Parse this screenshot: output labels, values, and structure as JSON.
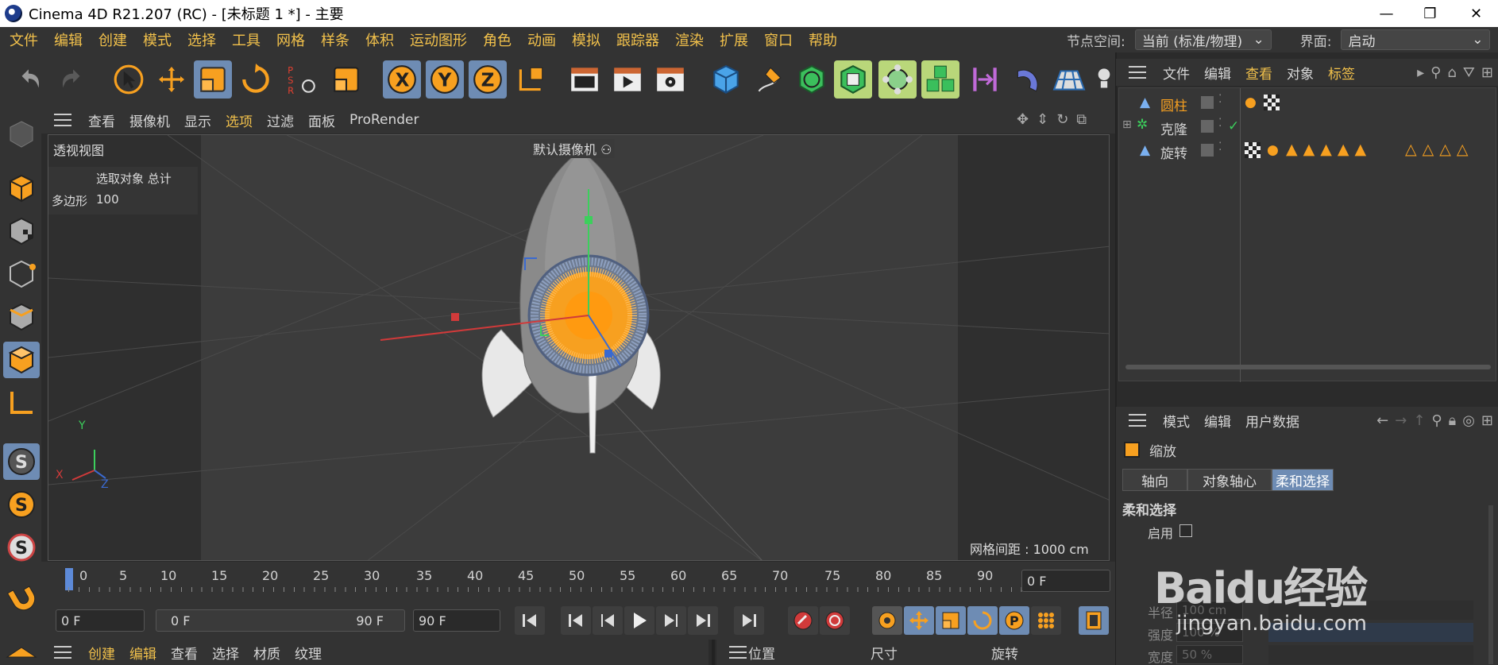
{
  "window": {
    "title": "Cinema 4D R21.207 (RC) - [未标题 1 *] - 主要",
    "minimize": "—",
    "maximize": "❐",
    "close": "✕"
  },
  "menubar": {
    "items": [
      "文件",
      "编辑",
      "创建",
      "模式",
      "选择",
      "工具",
      "网格",
      "样条",
      "体积",
      "运动图形",
      "角色",
      "动画",
      "模拟",
      "跟踪器",
      "渲染",
      "扩展",
      "窗口",
      "帮助"
    ],
    "node_space_label": "节点空间:",
    "node_space_value": "当前 (标准/物理)",
    "layout_label": "界面:",
    "layout_value": "启动"
  },
  "viewport": {
    "menu": [
      "查看",
      "摄像机",
      "显示",
      "选项",
      "过滤",
      "面板",
      "ProRender"
    ],
    "view_name": "透视视图",
    "camera_label": "默认摄像机",
    "hud_header": "选取对象 总计",
    "hud_polygons_label": "多边形",
    "hud_polygons_value": "100",
    "grid_spacing": "网格间距 : 1000 cm",
    "axis_x": "X",
    "axis_y": "Y",
    "axis_z": "Z"
  },
  "timeline": {
    "ticks": [
      "0",
      "5",
      "10",
      "15",
      "20",
      "25",
      "30",
      "35",
      "40",
      "45",
      "50",
      "55",
      "60",
      "65",
      "70",
      "75",
      "80",
      "85",
      "90"
    ],
    "current_frame": "0 F",
    "start_field": "0 F",
    "range_start": "0 F",
    "range_end": "90 F",
    "end_field": "90 F"
  },
  "object_manager": {
    "menu": [
      "文件",
      "编辑",
      "查看",
      "对象",
      "标签"
    ],
    "objects": [
      {
        "name": "圆柱",
        "active": true
      },
      {
        "name": "克隆",
        "active": false
      },
      {
        "name": "旋转",
        "active": false
      }
    ]
  },
  "attribute_manager": {
    "menu": [
      "模式",
      "编辑",
      "用户数据"
    ],
    "tool_name": "缩放",
    "tabs": [
      "轴向",
      "对象轴心",
      "柔和选择"
    ],
    "active_tab": "柔和选择",
    "section_title": "柔和选择",
    "enable_label": "启用",
    "radius_label": "半径",
    "radius_value": "100 cm",
    "strength_label": "强度",
    "strength_value": "100 %",
    "width_label": "宽度",
    "width_value": "50 %"
  },
  "material_manager": {
    "menu": [
      "创建",
      "编辑",
      "查看",
      "选择",
      "材质",
      "纹理"
    ]
  },
  "coordinates": {
    "headers": [
      "位置",
      "尺寸",
      "旋转"
    ]
  },
  "watermark": {
    "brand": "Baidu经验",
    "url": "jingyan.baidu.com"
  },
  "colors": {
    "accent_menu": "#f2c14b",
    "active_button": "#6e8cb4",
    "selection_orange": "#f7a020"
  }
}
